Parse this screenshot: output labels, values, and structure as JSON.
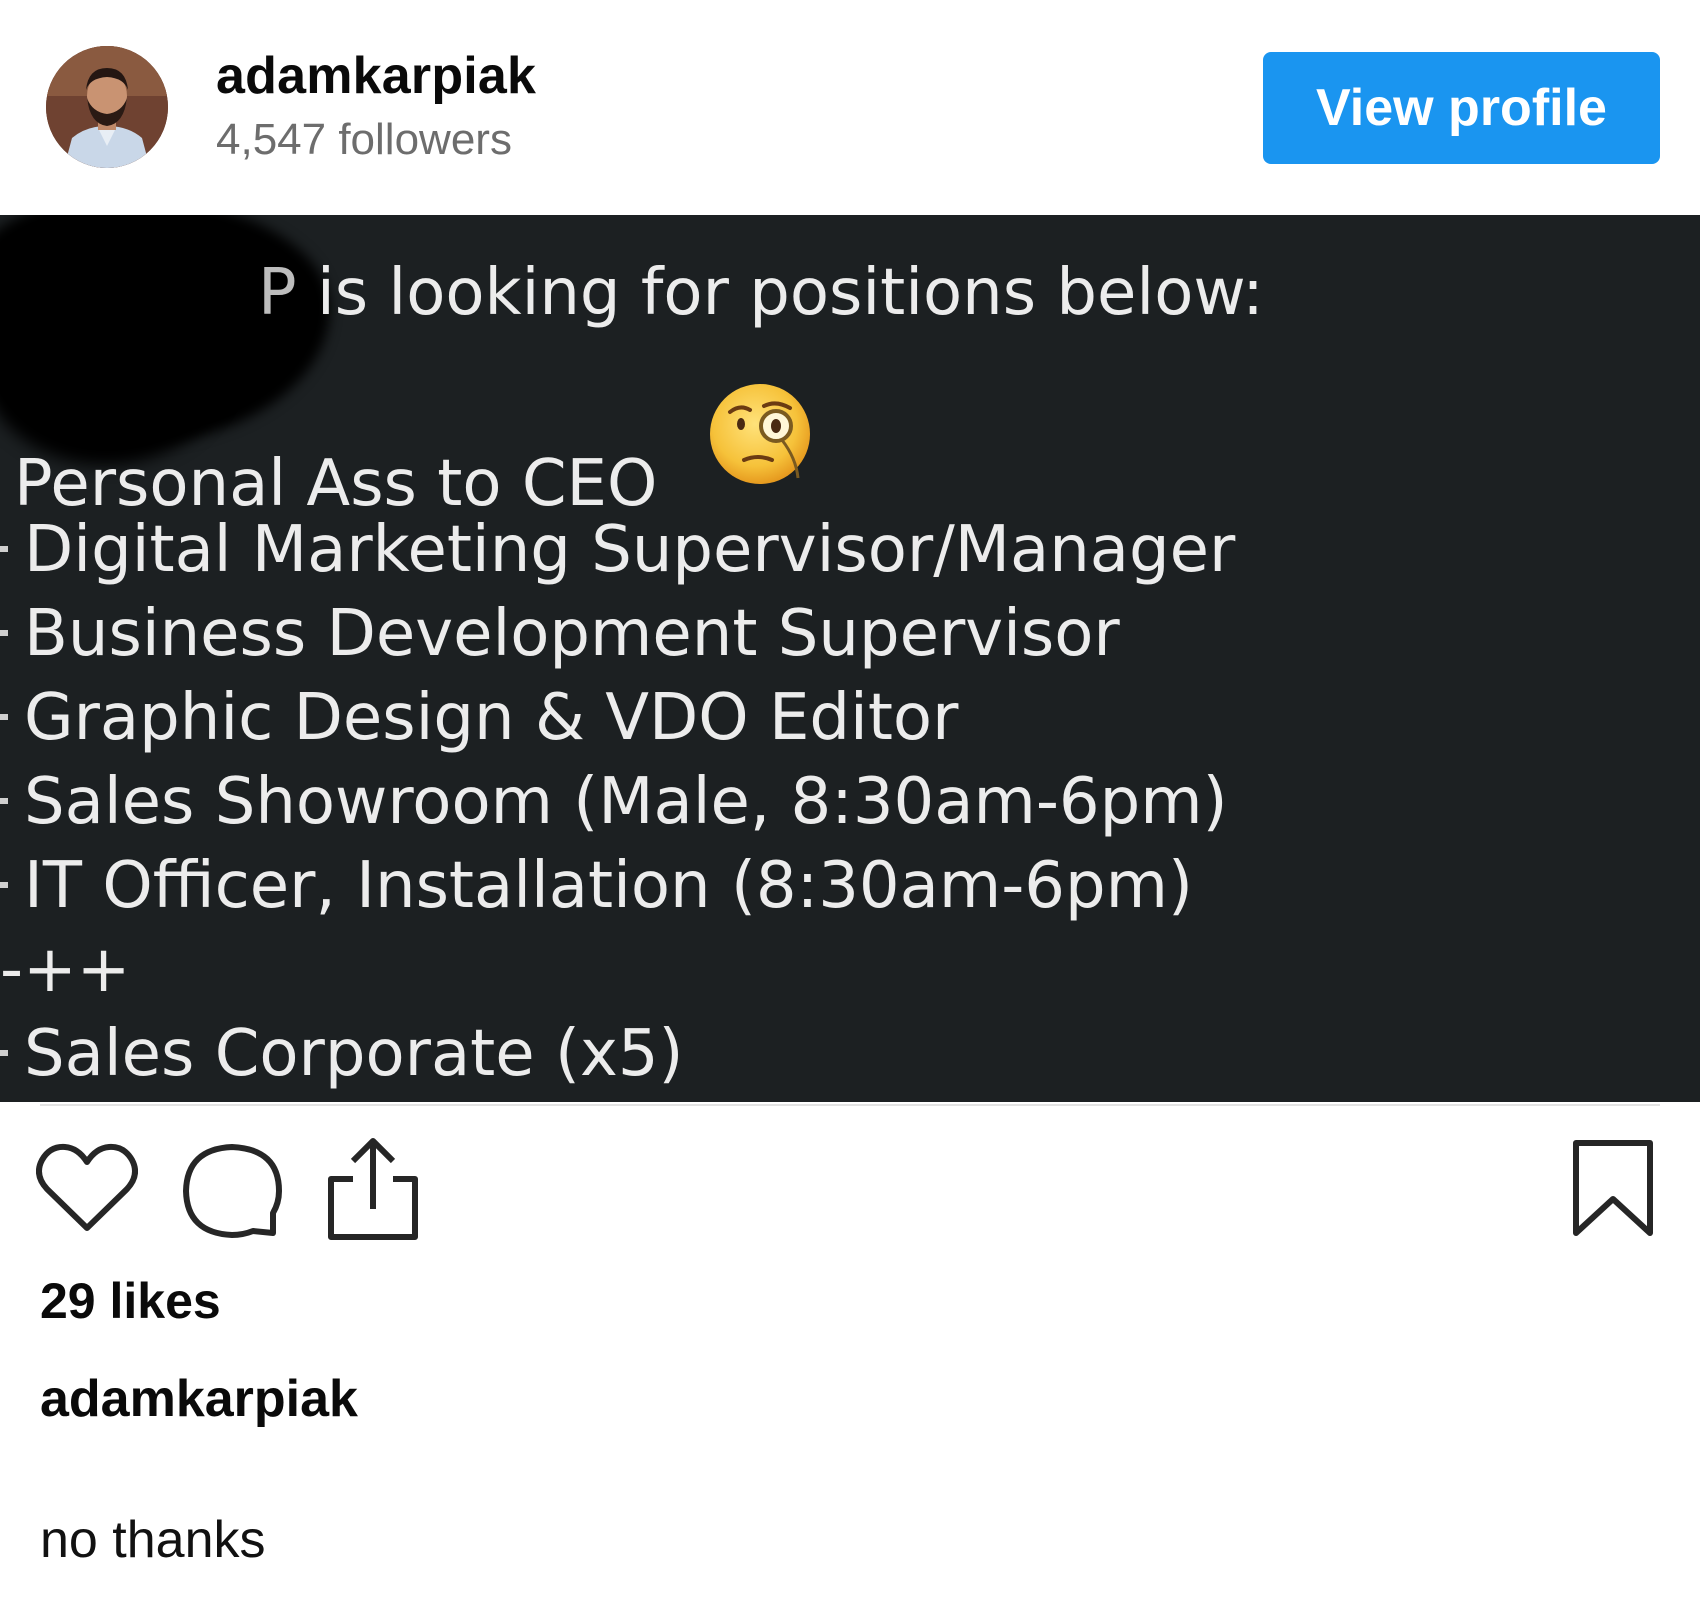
{
  "header": {
    "username": "adamkarpiak",
    "followers": "4,547 followers",
    "view_profile_label": "View profile",
    "accent_color": "#1a95f0"
  },
  "post_image": {
    "heading_fragment": "P",
    "heading_text": " is looking for positions below:",
    "lines": [
      "Personal Ass to CEO",
      "Digital Marketing Supervisor/Manager",
      "Business Development Supervisor",
      "Graphic Design & VDO Editor",
      "Sales Showroom (Male, 8:30am-6pm)",
      "IT Officer, Installation (8:30am-6pm)",
      "-++",
      "Sales Corporate (x5)"
    ],
    "emoji": "face-with-monocle-emoji",
    "background_color": "#1c2022"
  },
  "actions": {
    "icons": [
      "heart-icon",
      "comment-icon",
      "share-icon",
      "bookmark-icon"
    ]
  },
  "likes": "29 likes",
  "caption": {
    "username": "adamkarpiak",
    "text": "no thanks"
  }
}
